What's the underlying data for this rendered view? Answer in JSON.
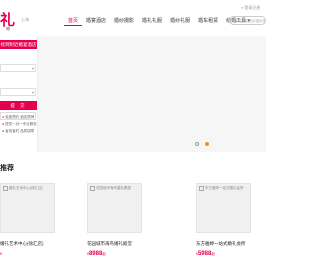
{
  "header": {
    "logo": "礼",
    "logo_sub": "婚",
    "city": "上海",
    "nav": [
      {
        "label": "首页",
        "active": true
      },
      {
        "label": "婚宴酒店",
        "active": false
      },
      {
        "label": "婚纱摄影",
        "active": false
      },
      {
        "label": "婚礼礼服",
        "active": false
      },
      {
        "label": "婚纱礼服",
        "active": false
      },
      {
        "label": "婚车租赁",
        "active": false
      },
      {
        "label": "结婚工具",
        "active": false
      }
    ],
    "search_placeholder": "搜索婚宴酒店/婚纱摄影",
    "login": "登录注册"
  },
  "banner": {
    "panel_title": "找到附近婚宴酒店",
    "fields": [
      "",
      "",
      ""
    ],
    "submit_label": "提 交",
    "tips": [
      "免费预约 酒店顾问",
      "提供一对一专业服务",
      "省钱省时 品质保障"
    ],
    "carousel": {
      "count": 2,
      "active_index": 1
    }
  },
  "section": {
    "title": "推荐"
  },
  "cards": [
    {
      "img_alt": "婚礼艺术中心(徐汇店)",
      "name": "婚礼艺术中心(徐汇店)",
      "price_prefix": "¥",
      "price": "",
      "price_suffix": ""
    },
    {
      "img_alt": "花园城市海鸟婚礼殿堂",
      "name": "花园城市海鸟婚礼殿堂",
      "price_prefix": "¥",
      "price": "8988",
      "price_suffix": "起"
    },
    {
      "img_alt": "东方雅婷一站式婚礼会所",
      "name": "东方雅婷一站式婚礼会所",
      "price_prefix": "¥",
      "price": "5988",
      "price_suffix": "起"
    }
  ],
  "colors": {
    "brand": "#e5004f",
    "carousel_active": "#e59a00"
  }
}
